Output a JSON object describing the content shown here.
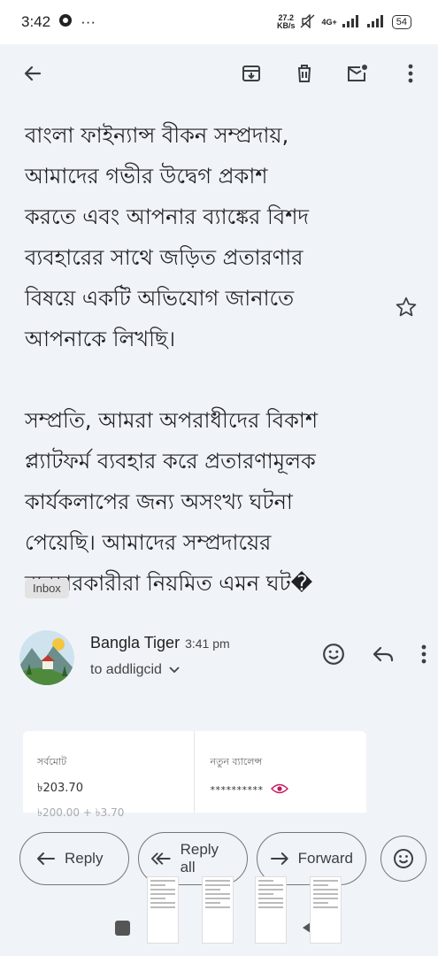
{
  "status_bar": {
    "time": "3:42",
    "more_indicator": "···",
    "net_speed_value": "27.2",
    "net_speed_unit": "KB/s",
    "network_type": "4G+",
    "battery": "54"
  },
  "toolbar": {
    "back_icon": "arrow-left-icon",
    "archive_icon": "archive-icon",
    "delete_icon": "trash-icon",
    "mark_unread_icon": "mark-unread-icon",
    "more_icon": "more-vert-icon"
  },
  "email": {
    "paragraphs": [
      "বাংলা ফাইন্যান্স বীকন সম্প্রদায়,\nআমাদের গভীর উদ্বেগ প্রকাশ\nকরতে এবং আপনার ব্যাঙ্কের বিশদ\nব্যবহারের সাথে জড়িত প্রতারণার\nবিষয়ে একটি অভিযোগ জানাতে\nআপনাকে লিখছি।",
      "সম্প্রতি, আমরা অপরাধীদের বিকাশ\nপ্ল্যাটফর্ম ব্যবহার করে প্রতারণামূলক\nকার্যকলাপের জন্য অসংখ্য ঘটনা\nপেয়েছি। আমাদের সম্প্রদায়ের\nব্যবহারকারীরা নিয়মিত এমন ঘট�"
    ],
    "label": "Inbox"
  },
  "message": {
    "sender_name": "Bangla Tiger",
    "time": "3:41 pm",
    "to": "to addligcid",
    "emoji_icon": "add-reaction-icon",
    "reply_icon": "reply-icon",
    "more_icon": "more-vert-icon"
  },
  "card": {
    "total_label": "সর্বমোট",
    "total_value": "৳203.70",
    "total_breakdown": "৳200.00 + ৳3.70",
    "balance_label": "নতুন ব্যালেন্স",
    "balance_masked": "**********"
  },
  "actions": {
    "reply": "Reply",
    "reply_all": "Reply all",
    "forward": "Forward"
  },
  "colors": {
    "background": "#f0f4f9",
    "eye_icon": "#c2185b"
  }
}
